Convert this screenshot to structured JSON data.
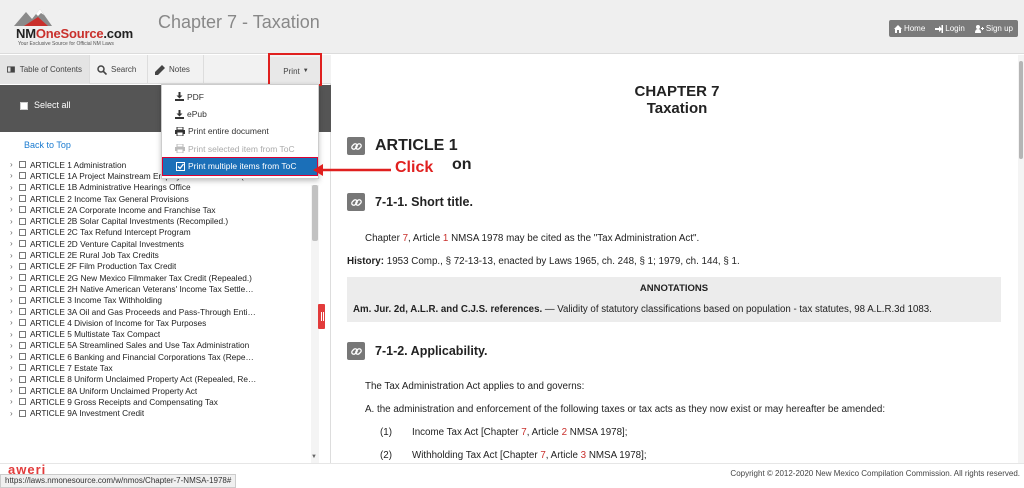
{
  "header": {
    "logo_brand_prefix": "NM",
    "logo_brand_accent": "OneSource",
    "logo_brand_suffix": ".com",
    "logo_tagline": "Your Exclusive Source for Official NM Laws",
    "title": "Chapter 7 - Taxation",
    "buttons": [
      {
        "label": "Home",
        "icon": "home-icon"
      },
      {
        "label": "Login",
        "icon": "login-icon"
      },
      {
        "label": "Sign up",
        "icon": "add-user-icon"
      }
    ]
  },
  "sidebar": {
    "tabs": [
      {
        "label": "Table of Contents",
        "icon": "book-icon",
        "active": true
      },
      {
        "label": "Search",
        "icon": "search-icon"
      },
      {
        "label": "Notes",
        "icon": "pencil-icon"
      }
    ],
    "print_label": "Print",
    "select_all": "Select all",
    "back_to_top": "Back to Top",
    "toc_items": [
      "ARTICLE 1 Administration",
      "ARTICLE 1A Project Mainstream Employment Tax Credit (…",
      "ARTICLE 1B Administrative Hearings Office",
      "ARTICLE 2 Income Tax General Provisions",
      "ARTICLE 2A Corporate Income and Franchise Tax",
      "ARTICLE 2B Solar Capital Investments (Recompiled.)",
      "ARTICLE 2C Tax Refund Intercept Program",
      "ARTICLE 2D Venture Capital Investments",
      "ARTICLE 2E Rural Job Tax Credits",
      "ARTICLE 2F Film Production Tax Credit",
      "ARTICLE 2G New Mexico Filmmaker Tax Credit (Repealed.)",
      "ARTICLE 2H Native American Veterans' Income Tax Settle…",
      "ARTICLE 3 Income Tax Withholding",
      "ARTICLE 3A Oil and Gas Proceeds and Pass-Through Enti…",
      "ARTICLE 4 Division of Income for Tax Purposes",
      "ARTICLE 5 Multistate Tax Compact",
      "ARTICLE 5A Streamlined Sales and Use Tax Administration",
      "ARTICLE 6 Banking and Financial Corporations Tax (Repe…",
      "ARTICLE 7 Estate Tax",
      "ARTICLE 8 Uniform Unclaimed Property Act (Repealed, Re…",
      "ARTICLE 8A Uniform Unclaimed Property Act",
      "ARTICLE 9 Gross Receipts and Compensating Tax",
      "ARTICLE 9A Investment Credit"
    ]
  },
  "print_menu": {
    "items": [
      {
        "label": "PDF",
        "icon": "download-icon",
        "state": "normal"
      },
      {
        "label": "ePub",
        "icon": "download-icon",
        "state": "normal"
      },
      {
        "label": "Print entire document",
        "icon": "printer-icon",
        "state": "normal"
      },
      {
        "label": "Print selected item from ToC",
        "icon": "printer-icon",
        "state": "disabled"
      },
      {
        "label": "Print multiple items from ToC",
        "icon": "checkbox-icon",
        "state": "selected"
      }
    ]
  },
  "annotation_callout": {
    "label": "Click",
    "color": "#e0201f"
  },
  "document": {
    "chapter": "CHAPTER 7",
    "chapter_title": "Taxation",
    "article": "ARTICLE 1",
    "article_sub_partial": "on",
    "sections": [
      {
        "title": "7-1-1. Short title."
      },
      {
        "title": "7-1-2. Applicability."
      }
    ],
    "para1": {
      "a": "Chapter ",
      "r1": "7",
      "b": ", Article ",
      "r2": "1",
      "c": " NMSA 1978 may be cited as the \"Tax Administration Act\"."
    },
    "history_label": "History:",
    "history_text": " 1953 Comp., § 72-13-13, enacted by Laws 1965, ch. 248, § 1; 1979, ch. 144, § 1.",
    "annotations_heading": "ANNOTATIONS",
    "annotations_label": "Am. Jur. 2d, A.L.R. and C.J.S. references.",
    "annotations_text": " — Validity of statutory classifications based on population - tax statutes, 98 A.L.R.3d 1083.",
    "applies_text": "The Tax Administration Act applies to and governs:",
    "item_a": "A.  the administration and enforcement of the following taxes or tax acts as they now exist or may hereafter be amended:",
    "item_1": {
      "num": "(1)",
      "a": "Income Tax Act [Chapter ",
      "r1": "7",
      "b": ", Article ",
      "r2": "2",
      "c": " NMSA 1978];"
    },
    "item_2": {
      "num": "(2)",
      "a": "Withholding Tax Act [Chapter ",
      "r1": "7",
      "b": ", Article ",
      "r2": "3",
      "c": " NMSA 1978];"
    }
  },
  "footer": {
    "copyright": "Copyright © 2012-2020 New Mexico Compilation Commission. All rights reserved.",
    "status_url": "https://laws.nmonesource.com/w/nmos/Chapter-7-NMSA-1978#",
    "logo_text": "aweri"
  },
  "colors": {
    "accent_red": "#e0201f",
    "menu_selected": "#1b6fb8",
    "link_blue": "#1a7bd0"
  }
}
